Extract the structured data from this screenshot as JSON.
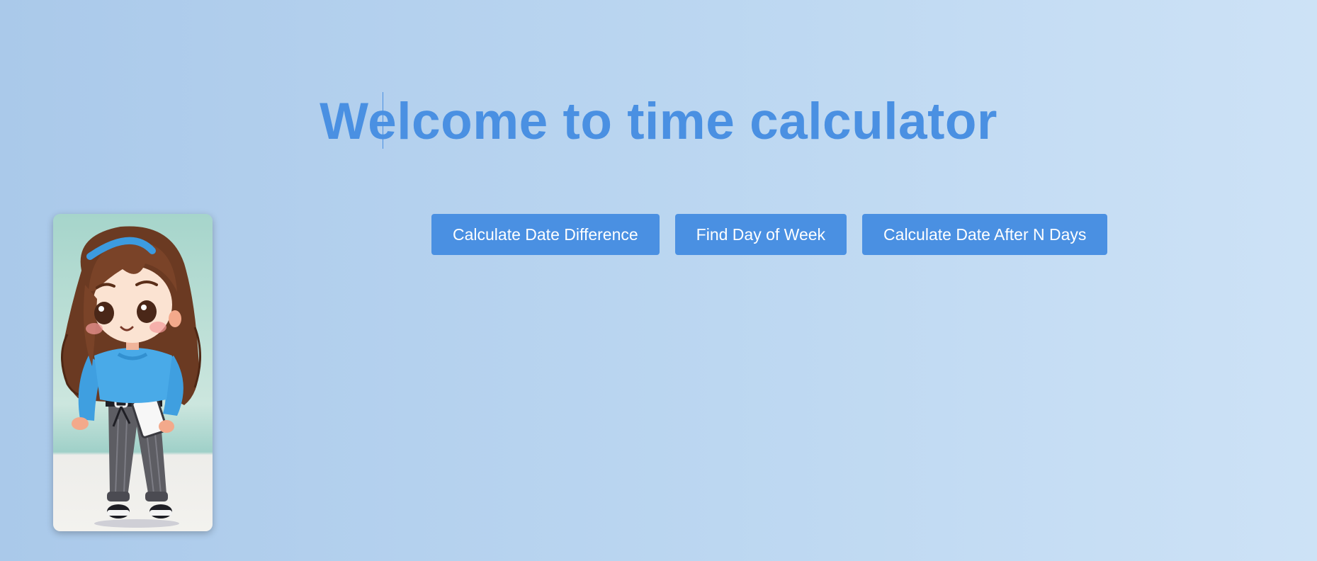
{
  "page": {
    "title": "Welcome to time calculator"
  },
  "buttons": [
    {
      "label": "Calculate Date Difference"
    },
    {
      "label": "Find Day of Week"
    },
    {
      "label": "Calculate Date After N Days"
    }
  ],
  "colors": {
    "accent": "#4a90e2",
    "button_text": "#ffffff",
    "background_start": "#aac9ea",
    "background_end": "#cde2f6"
  },
  "avatar": {
    "icon": "cartoon-girl-avatar"
  }
}
